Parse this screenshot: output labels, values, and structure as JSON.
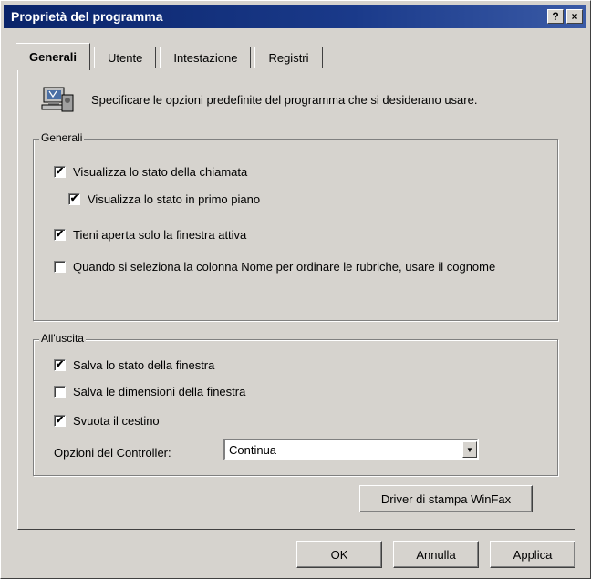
{
  "window": {
    "title": "Proprietà del programma",
    "help_button": "?",
    "close_button": "×"
  },
  "tabs": [
    {
      "label": "Generali",
      "active": true
    },
    {
      "label": "Utente",
      "active": false
    },
    {
      "label": "Intestazione",
      "active": false
    },
    {
      "label": "Registri",
      "active": false
    }
  ],
  "intro": {
    "icon": "settings-computer-icon",
    "text": "Specificare le opzioni predefinite del programma che si desiderano usare."
  },
  "generali_group": {
    "legend": "Generali",
    "options": [
      {
        "label": "Visualizza lo stato della chiamata",
        "checked": true
      },
      {
        "label": "Visualizza lo stato in primo piano",
        "checked": true
      },
      {
        "label": "Tieni aperta solo la finestra attiva",
        "checked": true
      },
      {
        "label": "Quando si seleziona la colonna Nome per ordinare le rubriche, usare il cognome",
        "checked": false
      }
    ]
  },
  "alluscita_group": {
    "legend": "All'uscita",
    "options": [
      {
        "label": "Salva lo stato della finestra",
        "checked": true
      },
      {
        "label": "Salva le dimensioni della finestra",
        "checked": false
      },
      {
        "label": "Svuota il cestino",
        "checked": true
      }
    ],
    "controller_label": "Opzioni del Controller:",
    "controller_value": "Continua"
  },
  "buttons": {
    "driver": "Driver di stampa WinFax",
    "ok": "OK",
    "cancel": "Annulla",
    "apply": "Applica"
  }
}
